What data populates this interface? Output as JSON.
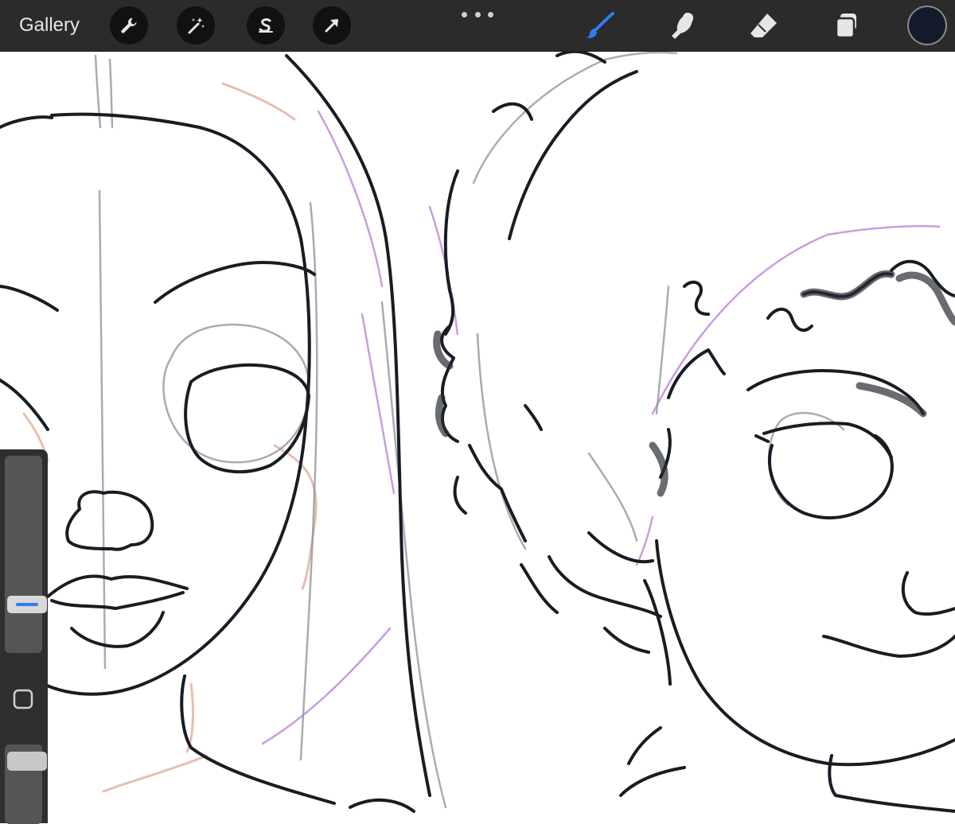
{
  "app": {
    "gallery_label": "Gallery"
  },
  "toolbar": {
    "left_tools": [
      {
        "name": "actions",
        "icon": "wrench-icon"
      },
      {
        "name": "adjustments",
        "icon": "magic-wand-icon"
      },
      {
        "name": "selection",
        "icon": "selection-s-icon"
      },
      {
        "name": "transform",
        "icon": "arrow-cursor-icon"
      }
    ],
    "more_icon": "ellipsis-icon",
    "right_tools": [
      {
        "name": "brush",
        "icon": "paintbrush-icon",
        "active": true
      },
      {
        "name": "smudge",
        "icon": "smudge-finger-icon",
        "active": false
      },
      {
        "name": "eraser",
        "icon": "eraser-icon",
        "active": false
      },
      {
        "name": "layers",
        "icon": "layers-icon",
        "active": false
      }
    ],
    "current_color": "#131a2b"
  },
  "sidebar": {
    "brush_size_level": 0.22,
    "modify_icon": "square-outline-icon",
    "opacity_level": 0.88
  },
  "colors": {
    "bar_background": "#2b2b2b",
    "icon_light": "#e6e6e6",
    "active_tool_blue": "#2f7cf6",
    "ink": "#181c24",
    "guide_pink": "#e2ad9c",
    "guide_purple": "#c08cd8"
  }
}
